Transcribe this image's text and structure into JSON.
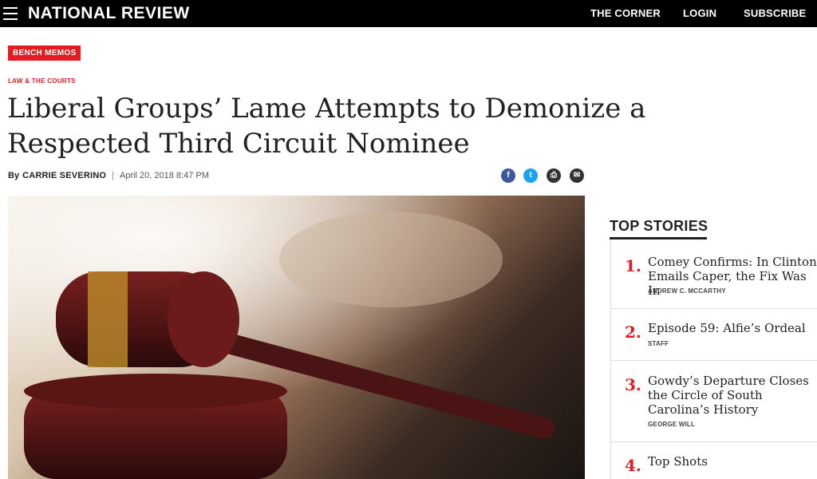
{
  "header": {
    "logo": "NATIONAL REVIEW",
    "nav": [
      "THE CORNER",
      "LOGIN",
      "SUBSCRIBE"
    ]
  },
  "article": {
    "badge": "BENCH MEMOS",
    "category": "LAW & THE COURTS",
    "headline": "Liberal Groups’ Lame Attempts to Demonize a Respected Third Circuit Nominee",
    "by": "By",
    "author": "CARRIE SEVERINO",
    "date": "April 20, 2018 8:47 PM",
    "share": [
      {
        "icon": "facebook-icon",
        "glyph": "f",
        "color": "#3b5998"
      },
      {
        "icon": "twitter-icon",
        "glyph": "t",
        "color": "#1da1f2"
      },
      {
        "icon": "print-icon",
        "glyph": "⎙",
        "color": "#333333"
      },
      {
        "icon": "email-icon",
        "glyph": "✉",
        "color": "#333333"
      }
    ]
  },
  "sidebar": {
    "title": "TOP STORIES",
    "stories": [
      {
        "num": "1.",
        "title": "Comey Confirms: In Clinton Emails Caper, the Fix Was In",
        "author": "ANDREW C. MCCARTHY"
      },
      {
        "num": "2.",
        "title": "Episode 59: Alfie’s Ordeal",
        "author": "STAFF"
      },
      {
        "num": "3.",
        "title": "Gowdy’s Departure Closes the Circle of South Carolina’s History",
        "author": "GEORGE WILL"
      },
      {
        "num": "4.",
        "title": "Top Shots",
        "author": ""
      }
    ]
  },
  "colors": {
    "accent": "#e31b23",
    "topbar": "#000000"
  }
}
